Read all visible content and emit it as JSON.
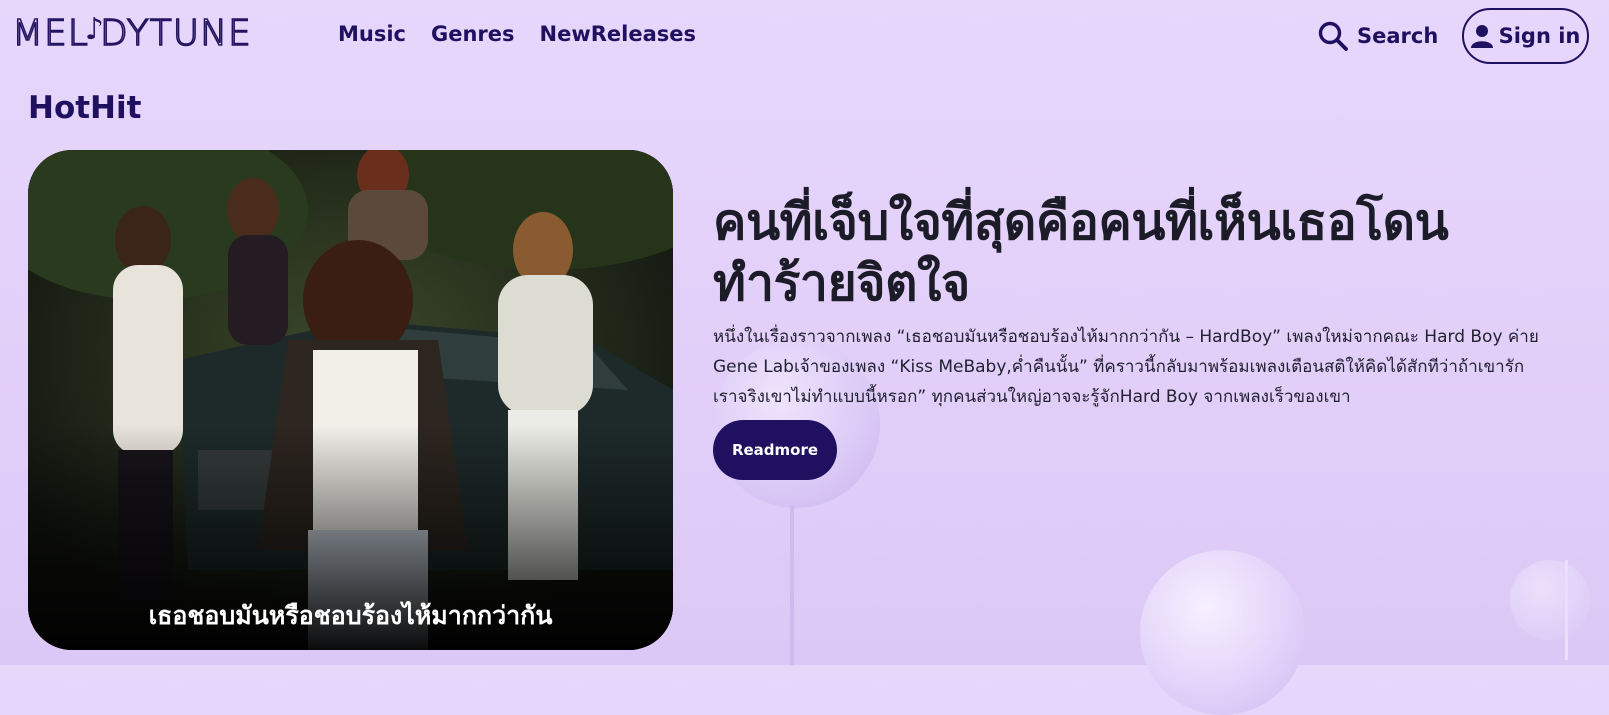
{
  "header": {
    "logo": {
      "text_before": "MEL",
      "text_after": "DYTUNE",
      "note_glyph": "♪"
    },
    "nav": [
      {
        "label": "Music"
      },
      {
        "label": "Genres"
      },
      {
        "label": "NewReleases"
      }
    ],
    "search": {
      "label": "Search",
      "icon": "search-icon"
    },
    "signin": {
      "label": "Sign in",
      "icon": "user-icon"
    }
  },
  "section": {
    "title": "HotHit"
  },
  "featured": {
    "image_caption": "เธอชอบมันหรือชอบร้องไห้มากกว่ากัน",
    "title": "คนที่เจ็บใจที่สุดคือคนที่เห็นเธอโดนทำร้ายจิตใจ",
    "excerpt": "หนึ่งในเรื่องราวจากเพลง “เธอชอบมันหรือชอบร้องไห้มากกว่ากัน – HardBoy” เพลงใหม่จากคณะ Hard Boy ค่าย Gene Labเจ้าของเพลง “Kiss MeBaby,ค่ำคืนนั้น” ที่คราวนี้กลับมาพร้อมเพลงเตือนสติให้คิดได้สักทีว่าถ้าเขารักเราจริงเขาไม่ทำแบบนี้หรอก” ทุกคนส่วนใหญ่อาจจะรู้จักHard Boy จากเพลงเร็วของเขา",
    "readmore_label": "Readmore"
  },
  "colors": {
    "brand": "#1f1060",
    "background": "#e4d3fa"
  }
}
